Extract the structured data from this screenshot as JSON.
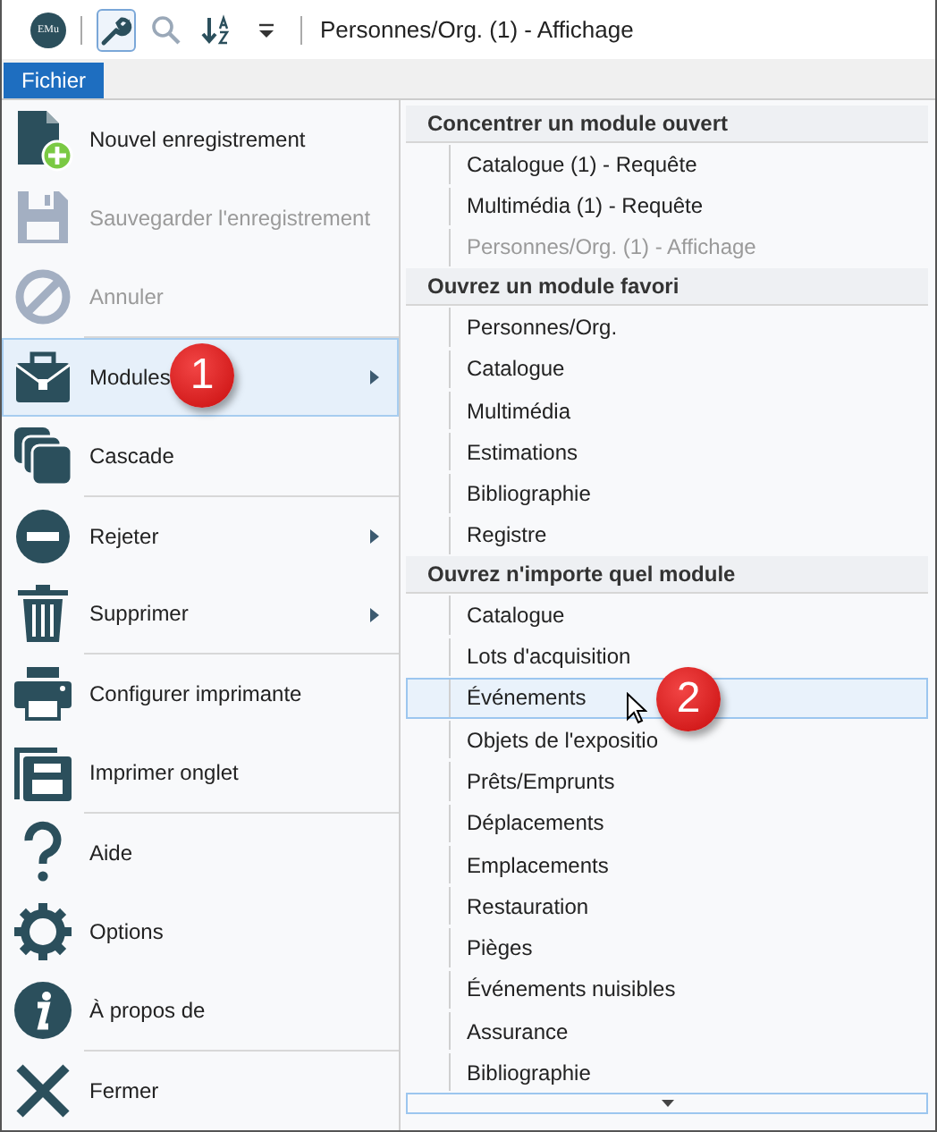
{
  "window": {
    "title": "Personnes/Org. (1) - Affichage",
    "logo": "EMu"
  },
  "toolbar": [
    {
      "kind": "wrench",
      "selected": true
    },
    {
      "kind": "search",
      "selected": false
    },
    {
      "kind": "sort",
      "selected": false
    },
    {
      "kind": "caret",
      "selected": false
    }
  ],
  "tabs": [
    {
      "label": "Fichier",
      "selected": true
    }
  ],
  "menu": {
    "groups": [
      [
        {
          "label": "Nouvel enregistrement",
          "disabled": false,
          "selected": false,
          "submenu": false
        },
        {
          "label": "Sauvegarder l'enregistrement",
          "disabled": true,
          "selected": false,
          "submenu": false
        },
        {
          "label": "Annuler",
          "disabled": true,
          "selected": false,
          "submenu": false
        }
      ],
      [
        {
          "label": "Modules",
          "disabled": false,
          "selected": true,
          "submenu": true,
          "callout": "1"
        },
        {
          "label": "Cascade",
          "disabled": false,
          "selected": false,
          "submenu": false
        }
      ],
      [
        {
          "label": "Rejeter",
          "disabled": false,
          "selected": false,
          "submenu": true
        },
        {
          "label": "Supprimer",
          "disabled": false,
          "selected": false,
          "submenu": true
        }
      ],
      [
        {
          "label": "Configurer imprimante",
          "disabled": false,
          "selected": false,
          "submenu": false
        },
        {
          "label": "Imprimer onglet",
          "disabled": false,
          "selected": false,
          "submenu": false
        }
      ],
      [
        {
          "label": "Aide",
          "disabled": false,
          "selected": false,
          "submenu": false
        },
        {
          "label": "Options",
          "disabled": false,
          "selected": false,
          "submenu": false
        },
        {
          "label": "À propos de",
          "disabled": false,
          "selected": false,
          "submenu": false
        }
      ],
      [
        {
          "label": "Fermer",
          "disabled": false,
          "selected": false,
          "submenu": false
        }
      ]
    ]
  },
  "submenu": {
    "sections": [
      {
        "heading": "Concentrer un module ouvert",
        "items": [
          {
            "label": "Catalogue (1) - Requête",
            "disabled": false,
            "selected": false
          },
          {
            "label": "Multimédia (1) - Requête",
            "disabled": false,
            "selected": false
          },
          {
            "label": "Personnes/Org. (1) - Affichage",
            "disabled": true,
            "selected": false
          }
        ]
      },
      {
        "heading": "Ouvrez un module favori",
        "items": [
          {
            "label": "Personnes/Org.",
            "disabled": false,
            "selected": false
          },
          {
            "label": "Catalogue",
            "disabled": false,
            "selected": false
          },
          {
            "label": "Multimédia",
            "disabled": false,
            "selected": false
          },
          {
            "label": "Estimations",
            "disabled": false,
            "selected": false
          },
          {
            "label": "Bibliographie",
            "disabled": false,
            "selected": false
          },
          {
            "label": "Registre",
            "disabled": false,
            "selected": false
          }
        ]
      },
      {
        "heading": "Ouvrez n'importe quel module",
        "items": [
          {
            "label": "Catalogue",
            "disabled": false,
            "selected": false
          },
          {
            "label": "Lots d'acquisition",
            "disabled": false,
            "selected": false
          },
          {
            "label": "Événements",
            "disabled": false,
            "selected": true,
            "callout": "2"
          },
          {
            "label": "Objets de l'expositio",
            "disabled": false,
            "selected": false
          },
          {
            "label": "Prêts/Emprunts",
            "disabled": false,
            "selected": false
          },
          {
            "label": "Déplacements",
            "disabled": false,
            "selected": false
          },
          {
            "label": "Emplacements",
            "disabled": false,
            "selected": false
          },
          {
            "label": "Restauration",
            "disabled": false,
            "selected": false
          },
          {
            "label": "Pièges",
            "disabled": false,
            "selected": false
          },
          {
            "label": "Événements nuisibles",
            "disabled": false,
            "selected": false
          },
          {
            "label": "Assurance",
            "disabled": false,
            "selected": false
          },
          {
            "label": "Bibliographie",
            "disabled": false,
            "selected": false
          }
        ]
      }
    ]
  }
}
